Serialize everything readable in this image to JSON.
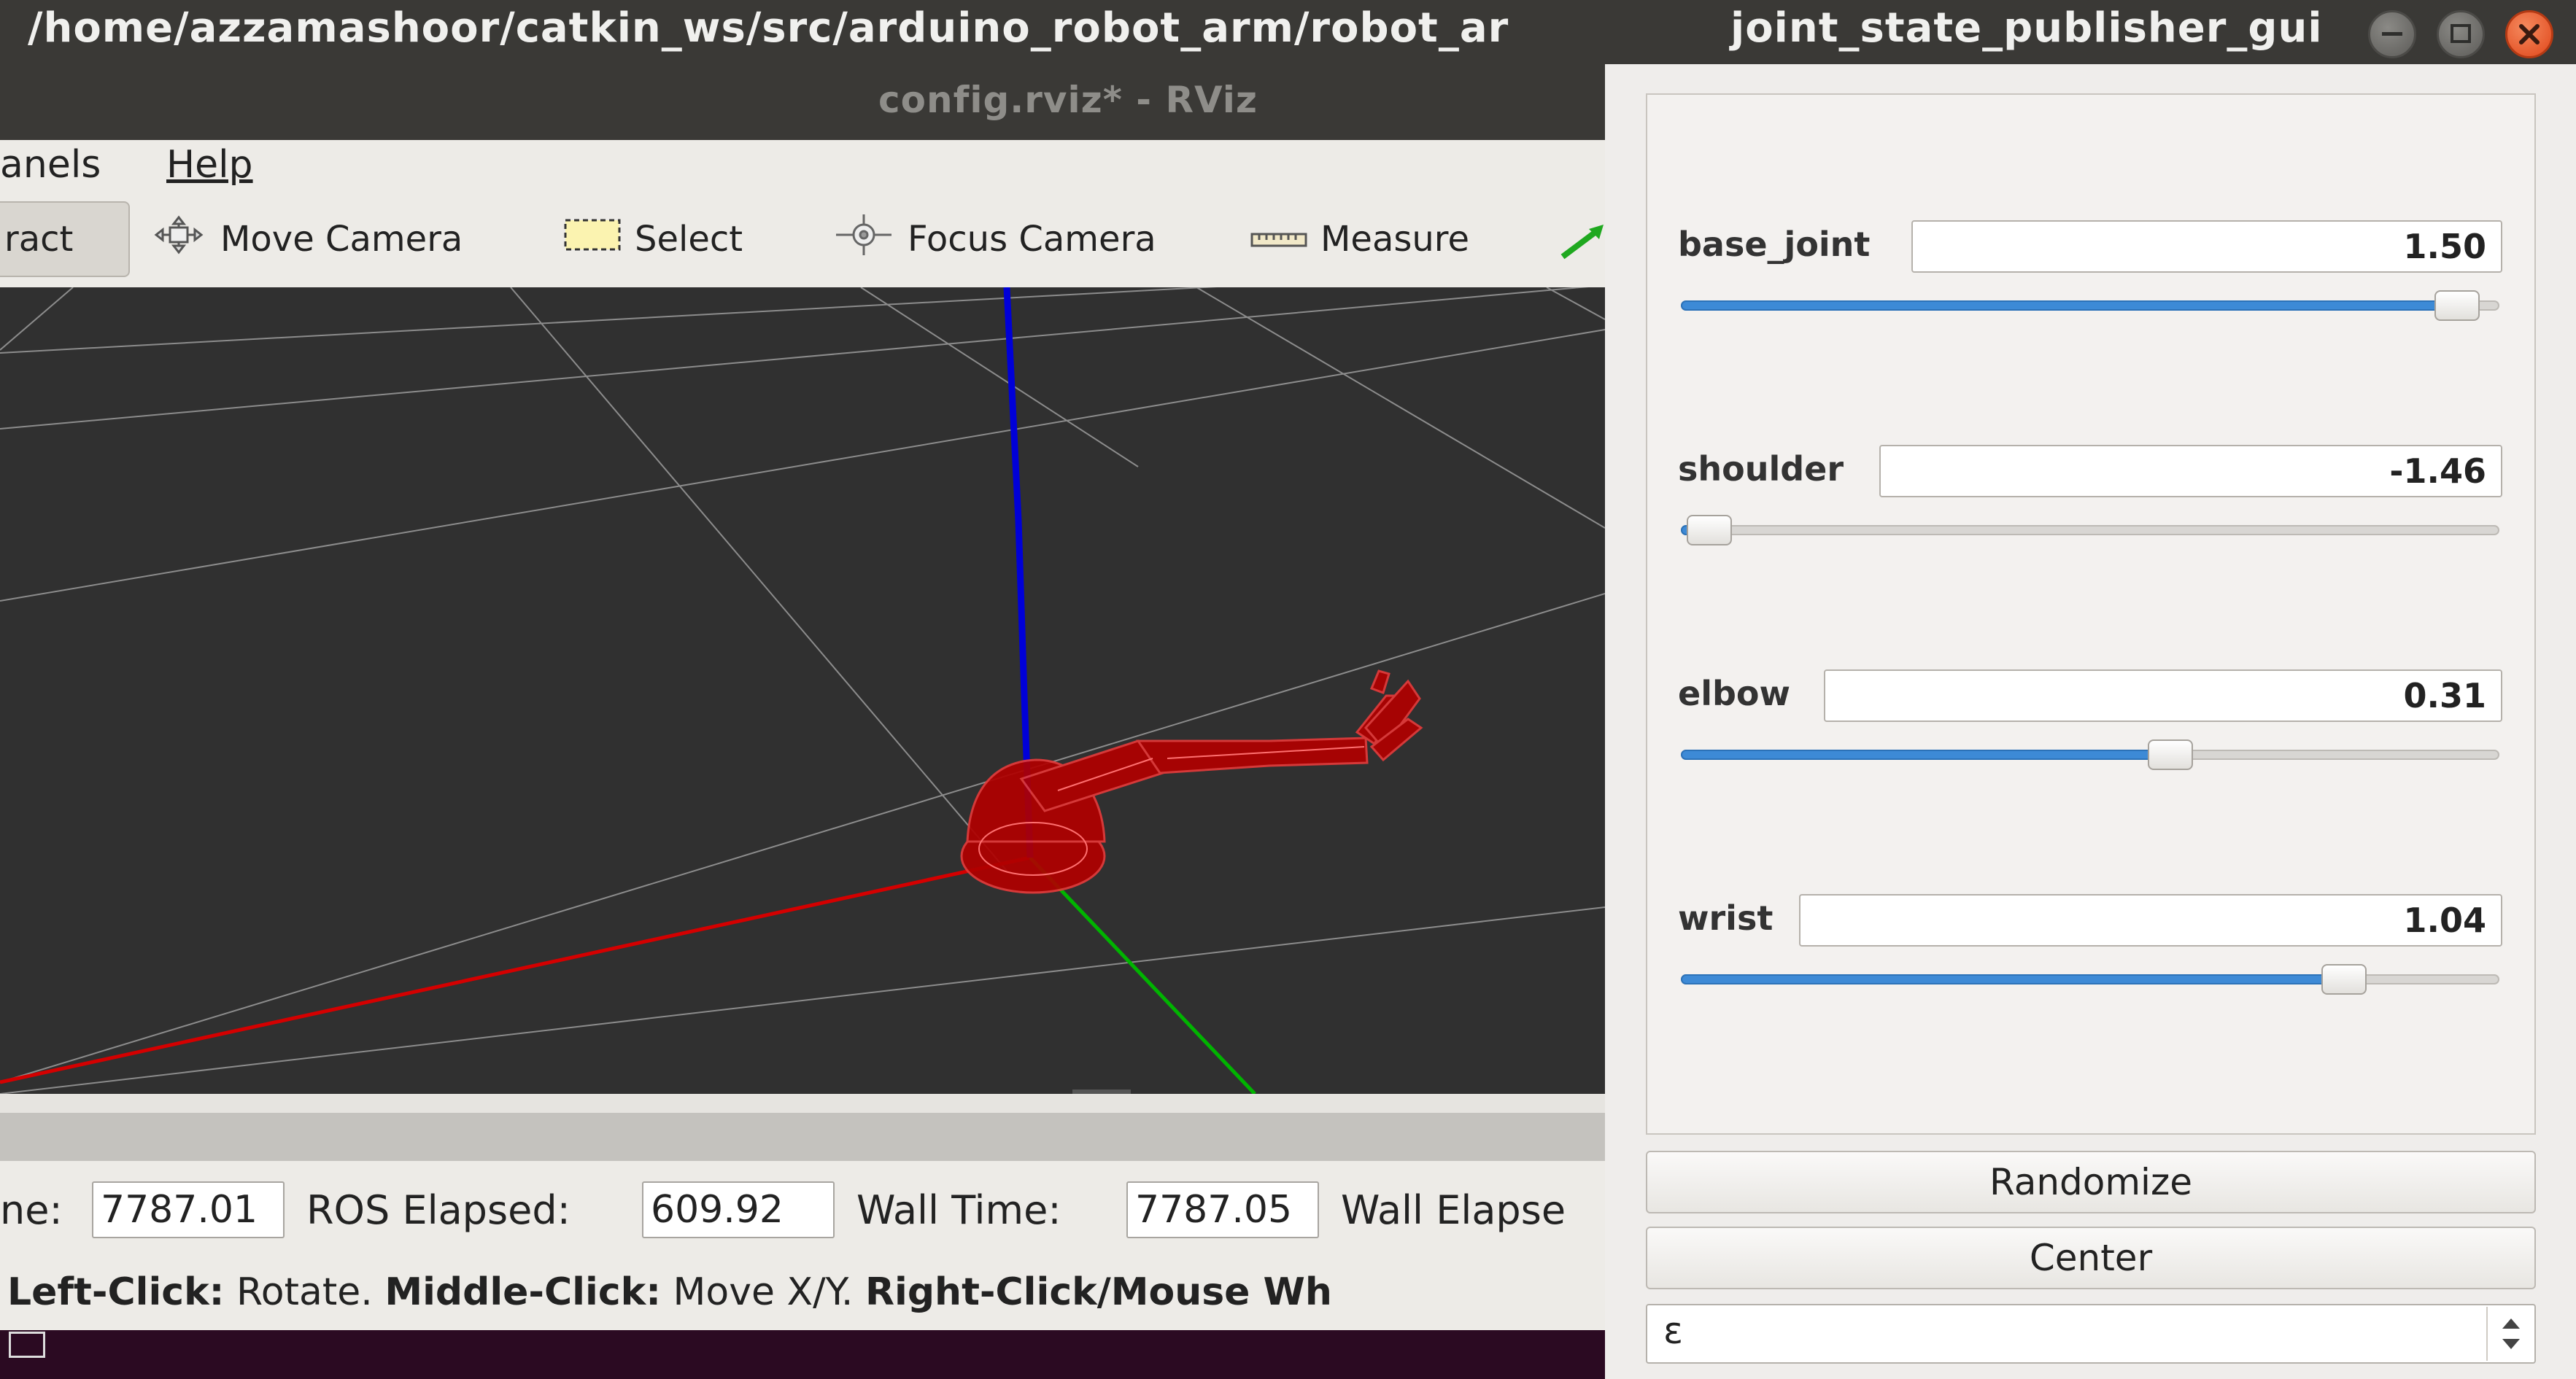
{
  "rviz": {
    "path_title": "/home/azzamashoor/catkin_ws/src/arduino_robot_arm/robot_ar",
    "window_title": "config.rviz* - RViz",
    "menu": [
      "anels",
      "Help"
    ],
    "toolbar": {
      "interact": "ract",
      "move_camera": "Move Camera",
      "select": "Select",
      "focus_camera": "Focus Camera",
      "measure": "Measure"
    },
    "time": {
      "ros_time_label": "ne:",
      "ros_time_value": "7787.01",
      "ros_elapsed_label": "ROS Elapsed:",
      "ros_elapsed_value": "609.92",
      "wall_time_label": "Wall Time:",
      "wall_time_value": "7787.05",
      "wall_elapsed_label": "Wall Elapse"
    },
    "hint": {
      "left_click": "Left-Click:",
      "left_action": " Rotate. ",
      "middle_click": "Middle-Click:",
      "middle_action": " Move X/Y. ",
      "right_click": "Right-Click/Mouse Wh"
    },
    "colors": {
      "x_axis": "#d40000",
      "y_axis": "#00b400",
      "z_axis": "#0000d8",
      "robot": "#b00000",
      "grid": "#8c8c8c"
    }
  },
  "jsp": {
    "window_title": "joint_state_publisher_gui",
    "joints": [
      {
        "name": "base_joint",
        "value": "1.50",
        "fraction": 0.948
      },
      {
        "name": "shoulder",
        "value": "-1.46",
        "fraction": 0.035
      },
      {
        "name": "elbow",
        "value": "0.31",
        "fraction": 0.598
      },
      {
        "name": "wrist",
        "value": "1.04",
        "fraction": 0.81
      }
    ],
    "randomize_label": "Randomize",
    "center_label": "Center",
    "spin_value": "ε",
    "colors": {
      "slider_fill": "#3d8ad6",
      "close_button": "#e8572a"
    }
  }
}
